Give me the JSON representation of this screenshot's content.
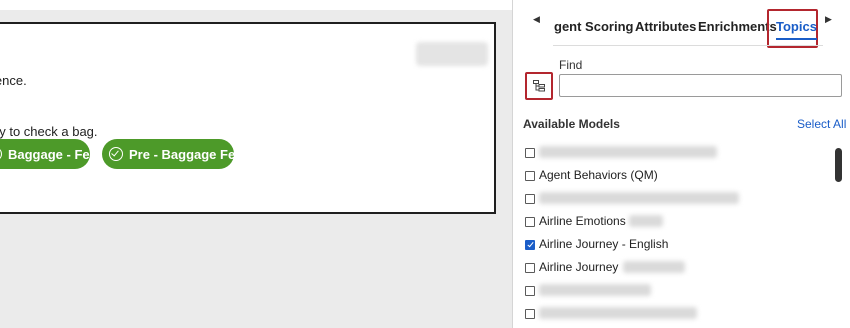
{
  "main": {
    "line1": "ience.",
    "line2": "ay to check a bag.",
    "chips": [
      "Baggage - Fee",
      "Pre - Baggage Fee"
    ]
  },
  "panel": {
    "tabs": [
      "gent Scoring",
      "Attributes",
      "Enrichments",
      "Topics"
    ],
    "active_tab": "Topics",
    "find_label": "Find",
    "find_value": "",
    "section_title": "Available Models",
    "select_all": "Select All",
    "models": [
      {
        "label": "",
        "checked": false
      },
      {
        "label": "Agent Behaviors (QM)",
        "checked": false
      },
      {
        "label": "",
        "checked": false
      },
      {
        "label": "Airline Emotions",
        "checked": false
      },
      {
        "label": "Airline Journey - English",
        "checked": true
      },
      {
        "label": "Airline Journey",
        "checked": false
      },
      {
        "label": "",
        "checked": false
      },
      {
        "label": "",
        "checked": false
      }
    ]
  },
  "icons": {
    "tab_left": "caret-left-icon",
    "tab_right": "caret-right-icon",
    "tree": "tree-structure-icon",
    "chip": "check-circle-icon"
  },
  "colors": {
    "accent": "#1a5dc8",
    "highlight": "#b3262e",
    "chip": "#4d9a29"
  }
}
